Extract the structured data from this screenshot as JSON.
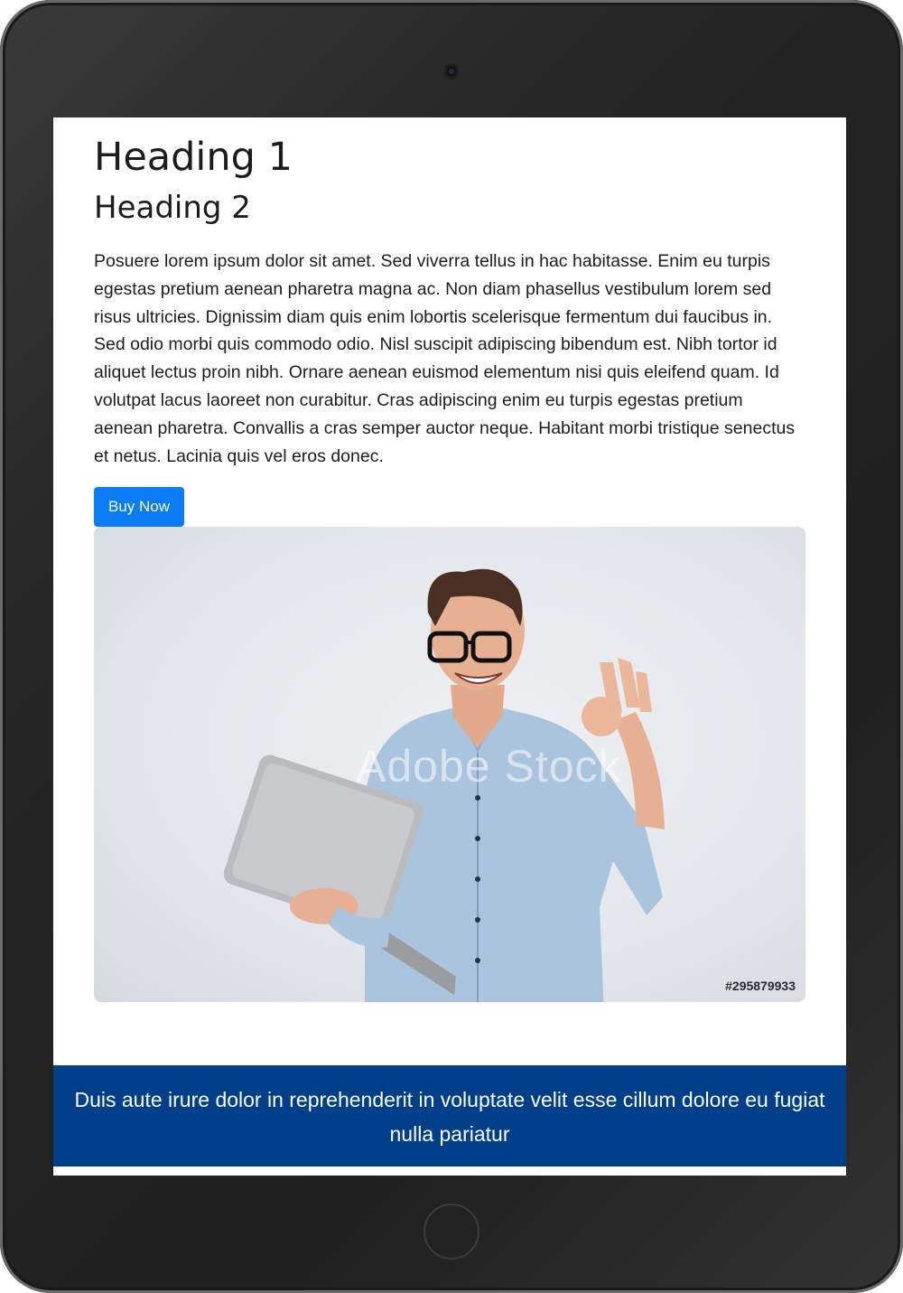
{
  "page": {
    "heading1": "Heading 1",
    "heading2": "Heading 2",
    "body": "Posuere lorem ipsum dolor sit amet. Sed viverra tellus in hac habitasse. Enim eu turpis egestas pretium aenean pharetra magna ac. Non diam phasellus vestibulum lorem sed risus ultricies. Dignissim diam quis enim lobortis scelerisque fermentum dui faucibus in. Sed odio morbi quis commodo odio. Nisl suscipit adipiscing bibendum est. Nibh tortor id aliquet lectus proin nibh. Ornare aenean euismod elementum nisi quis eleifend quam. Id volutpat lacus laoreet non curabitur. Cras adipiscing enim eu turpis egestas pretium aenean pharetra. Convallis a cras semper auctor neque. Habitant morbi tristique senectus et netus. Lacinia quis vel eros donec.",
    "button_label": "Buy Now",
    "hero": {
      "watermark": "Adobe Stock",
      "stock_id": "#295879933"
    },
    "banner": "Duis aute irure dolor in reprehenderit in voluptate velit esse cillum dolore eu fugiat nulla pariatur"
  },
  "colors": {
    "button": "#0a7cf6",
    "banner": "#003f8a",
    "device": "#262626"
  }
}
